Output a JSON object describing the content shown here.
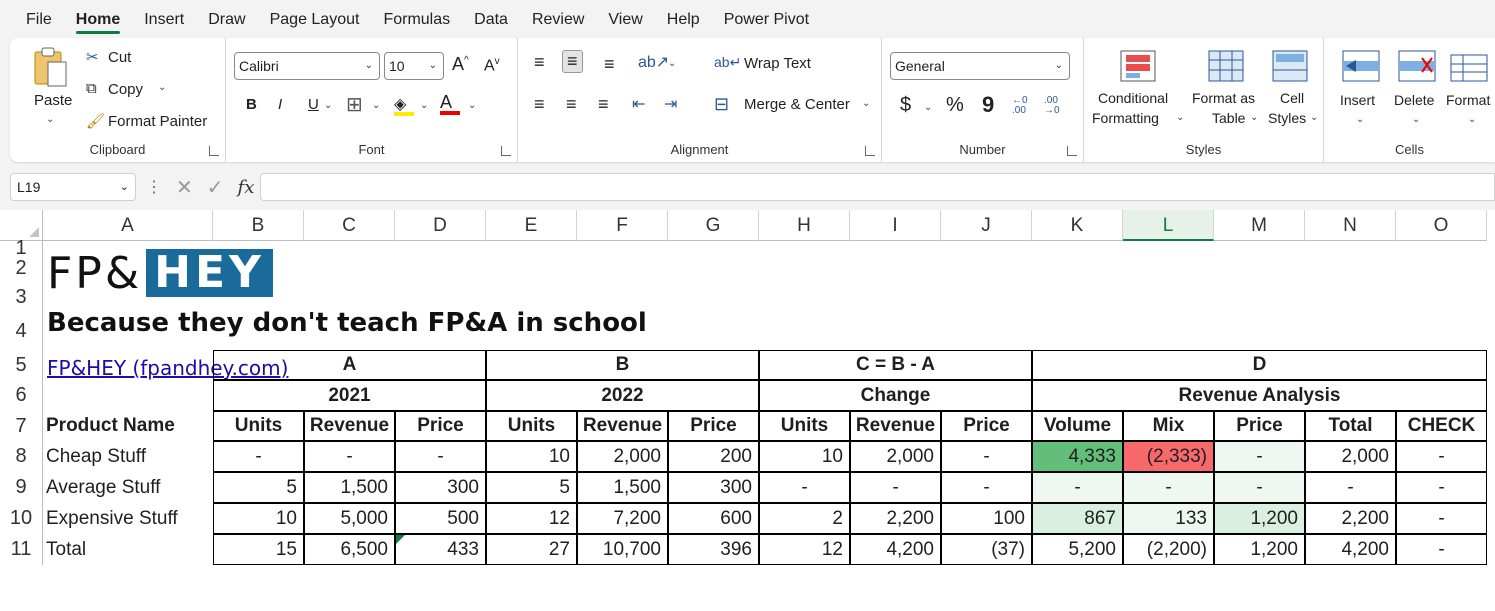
{
  "menu": [
    "File",
    "Home",
    "Insert",
    "Draw",
    "Page Layout",
    "Formulas",
    "Data",
    "Review",
    "View",
    "Help",
    "Power Pivot"
  ],
  "active_menu": "Home",
  "ribbon": {
    "clipboard": {
      "paste": "Paste",
      "cut": "Cut",
      "copy": "Copy",
      "format_painter": "Format Painter",
      "label": "Clipboard"
    },
    "font": {
      "font_name": "Calibri",
      "font_size": "10",
      "bold": "B",
      "italic": "I",
      "underline": "U",
      "label": "Font"
    },
    "alignment": {
      "wrap_text": "Wrap Text",
      "merge_center": "Merge & Center",
      "label": "Alignment"
    },
    "number": {
      "format": "General",
      "dollar": "$",
      "percent": "%",
      "comma": "9",
      "inc_dec": "←0 .00",
      "dec_dec": ".00 →0",
      "label": "Number"
    },
    "styles": {
      "conditional": "Conditional",
      "conditional2": "Formatting",
      "format_table": "Format as",
      "format_table2": "Table",
      "cell_styles": "Cell",
      "cell_styles2": "Styles",
      "label": "Styles"
    },
    "cells": {
      "insert": "Insert",
      "delete": "Delete",
      "format": "Format",
      "label": "Cells"
    }
  },
  "formula_bar": {
    "name_box": "L19",
    "fx": "fx",
    "formula": ""
  },
  "columns": [
    "A",
    "B",
    "C",
    "D",
    "E",
    "F",
    "G",
    "H",
    "I",
    "J",
    "K",
    "L",
    "M",
    "N",
    "O"
  ],
  "selected_column": "L",
  "rows": [
    "1",
    "2",
    "3",
    "4",
    "5",
    "6",
    "7",
    "8",
    "9",
    "10",
    "11"
  ],
  "sheet": {
    "logo_left": "FP&",
    "logo_right": "HEY",
    "tagline": "Because they don't teach FP&A in school",
    "link": "FP&HEY (fpandhey.com)",
    "group_headers": [
      "A",
      "B",
      "C = B - A",
      "D"
    ],
    "sub_headers": [
      "2021",
      "2022",
      "Change",
      "Revenue Analysis"
    ],
    "col_headers": [
      "Product Name",
      "Units",
      "Revenue",
      "Price",
      "Units",
      "Revenue",
      "Price",
      "Units",
      "Revenue",
      "Price",
      "Volume",
      "Mix",
      "Price",
      "Total",
      "CHECK"
    ],
    "data_rows": [
      [
        "Cheap Stuff",
        "-",
        "-",
        "-",
        "10",
        "2,000",
        "200",
        "10",
        "2,000",
        "-",
        "4,333",
        "(2,333)",
        "-",
        "2,000",
        "-"
      ],
      [
        "Average Stuff",
        "5",
        "1,500",
        "300",
        "5",
        "1,500",
        "300",
        "-",
        "-",
        "-",
        "-",
        "-",
        "-",
        "-",
        "-"
      ],
      [
        "Expensive Stuff",
        "10",
        "5,000",
        "500",
        "12",
        "7,200",
        "600",
        "2",
        "2,200",
        "100",
        "867",
        "133",
        "1,200",
        "2,200",
        "-"
      ],
      [
        "Total",
        "15",
        "6,500",
        "433",
        "27",
        "10,700",
        "396",
        "12",
        "4,200",
        "(37)",
        "5,200",
        "(2,200)",
        "1,200",
        "4,200",
        "-"
      ]
    ],
    "highlight_colors": {
      "green_strong": "#63be7b",
      "red": "#f8696b",
      "green_light": "#d9efdf",
      "green_lighter": "#eef7f0"
    }
  }
}
